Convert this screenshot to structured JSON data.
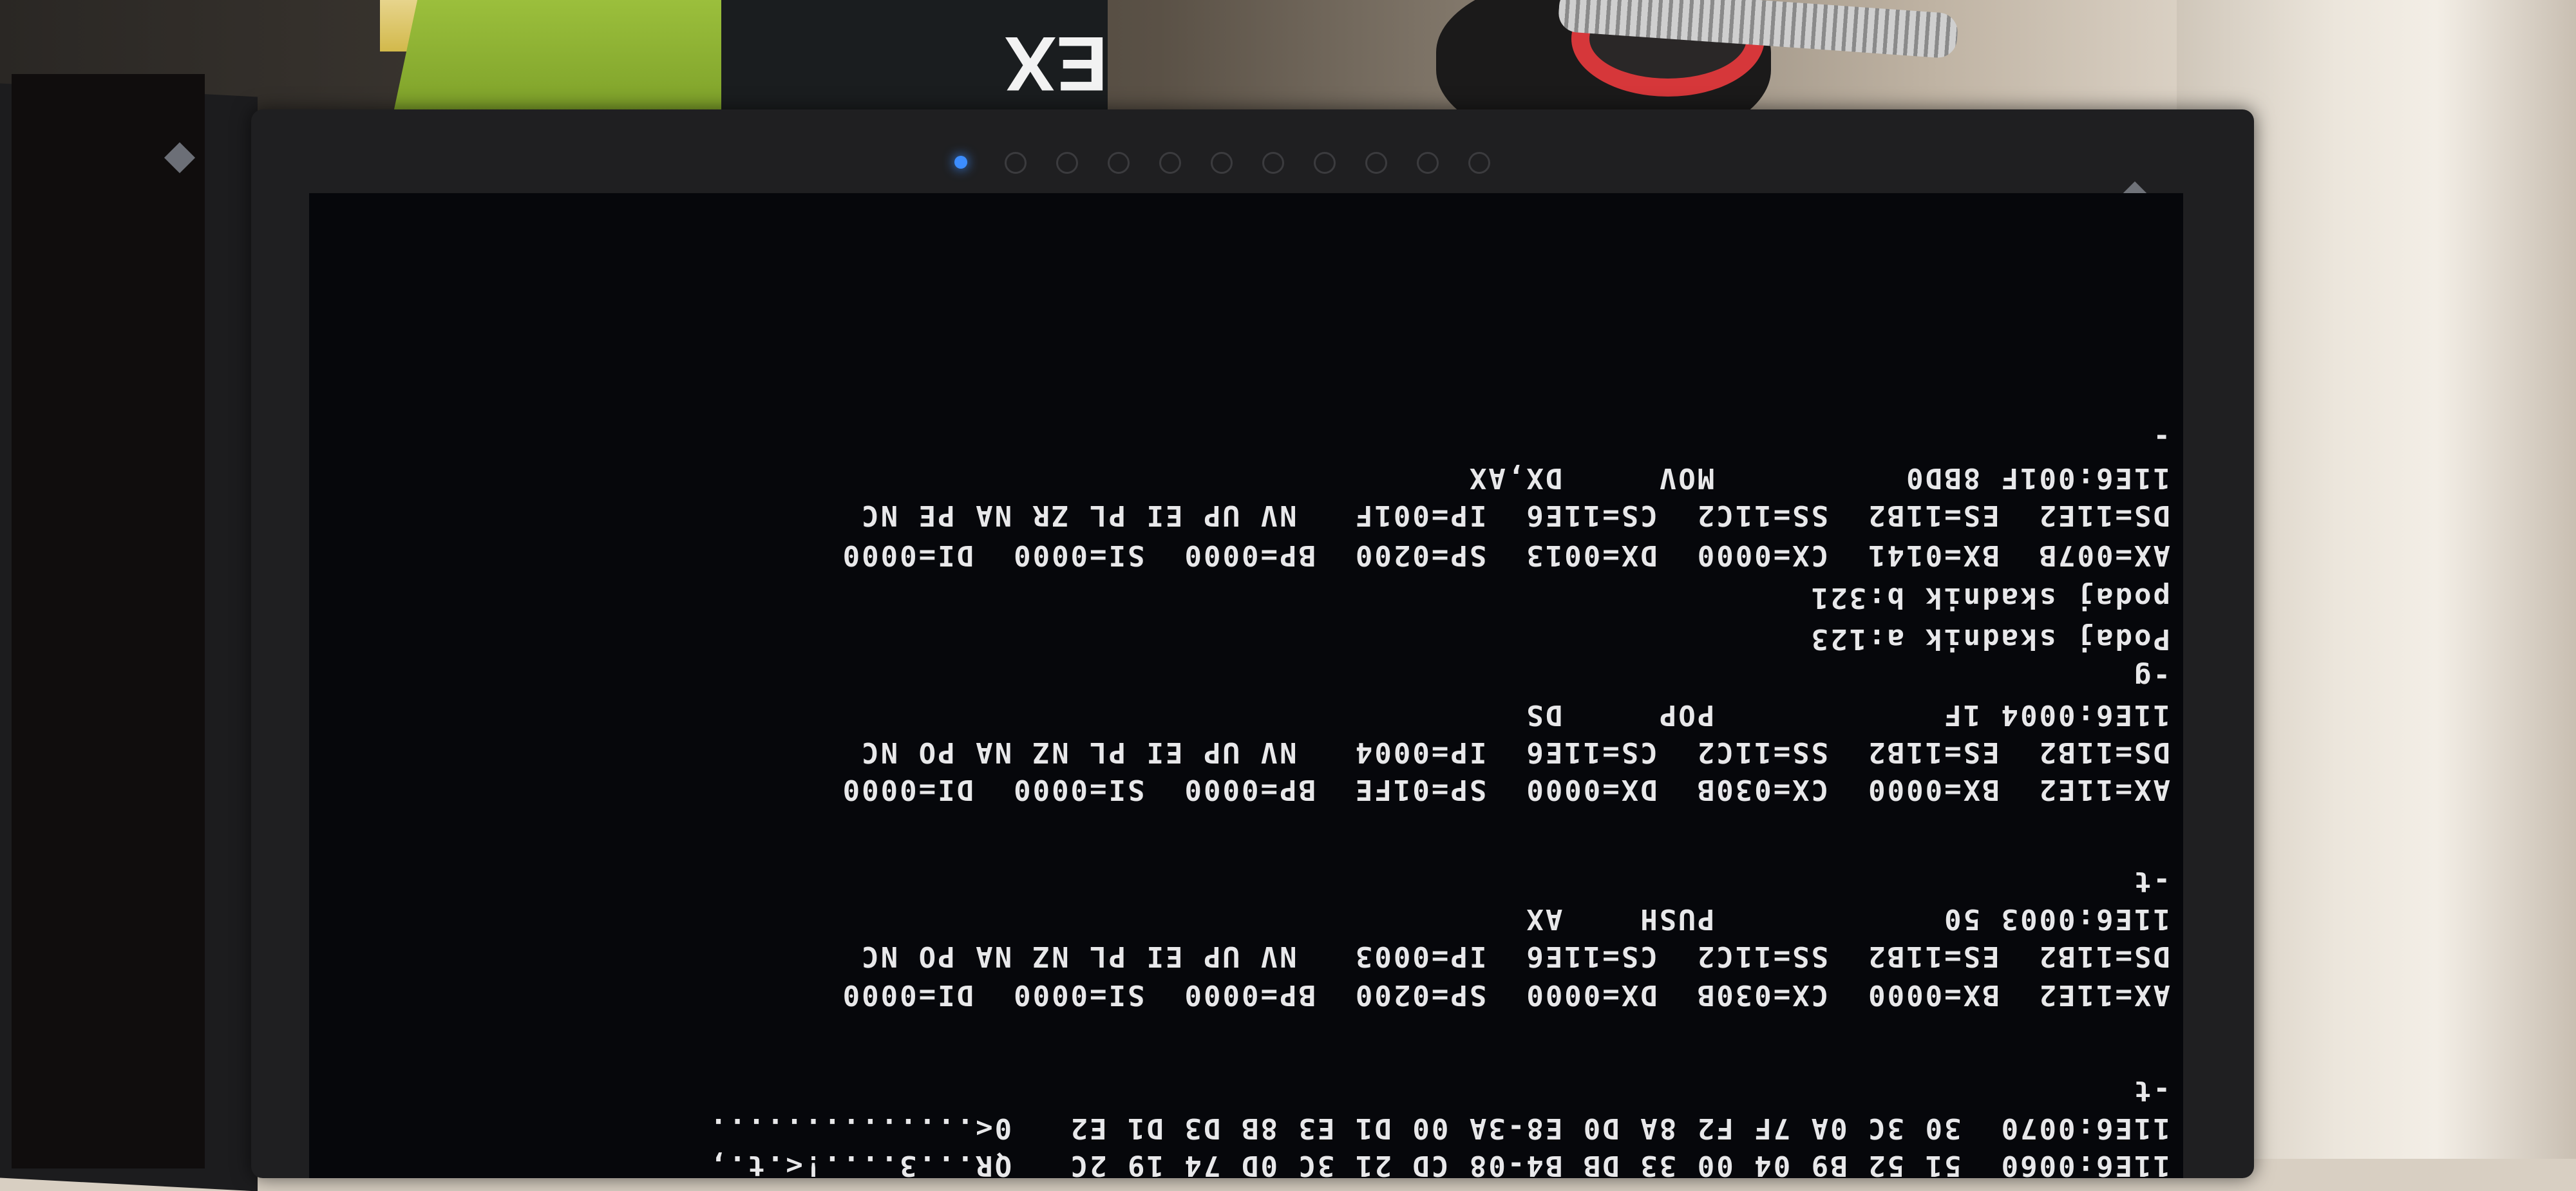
{
  "scene": {
    "box_label": "EX"
  },
  "console": {
    "lines": [
      "11E6:0060  51 52 B9 04 00 33 DB B4-08 CD 21 3C 0D 74 19 2C   QR...3....!<.t.,",
      "11E6:0070  30 3C 0A 7F F2 8A D0 E8-3A 00 D1 E3 8B D3 D1 E2   0<..............",
      "-t",
      "AX=11E2  BX=0000  CX=030B  DX=0000  SP=0200  BP=0000  SI=0000  DI=0000",
      "DS=11B2  ES=11B2  SS=11C2  CS=11E6  IP=0003   NV UP EI PL NZ NA PO NC",
      "11E6:0003 50            PUSH    AX",
      "-t",
      "AX=11E2  BX=0000  CX=030B  DX=0000  SP=01FE  BP=0000  SI=0000  DI=0000",
      "DS=11B2  ES=11B2  SS=11C2  CS=11E6  IP=0004   NV UP EI PL NZ NA PO NC",
      "11E6:0004 1F            POP     DS",
      "-g",
      "Podaj skadnik a:123",
      "podaj skadnik b:321",
      "AX=007B  BX=0141  CX=0000  DX=0013  SP=0200  BP=0000  SI=0000  DI=0000",
      "DS=11E2  ES=11B2  SS=11C2  CS=11E6  IP=001F   NV UP EI PL ZR NA PE NC",
      "11E6:001F 8BD0          MOV     DX,AX",
      "-"
    ]
  },
  "colors": {
    "screen_bg": "#06070b",
    "text": "#e8e8ea",
    "power_led": "#3c8dff",
    "bezel": "#1f1f21"
  },
  "icons": {
    "power_led": "power-led-icon",
    "logo": "diamond-logo-icon"
  }
}
